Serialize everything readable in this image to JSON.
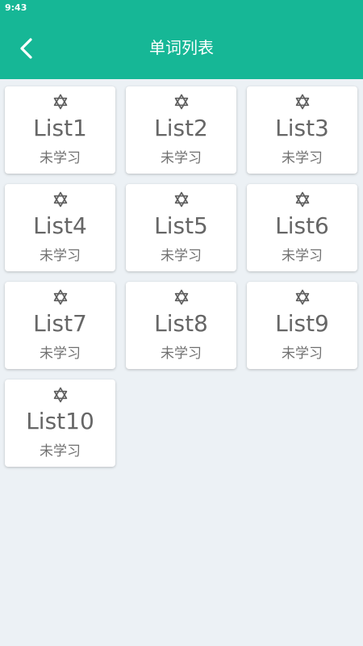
{
  "status_bar": {
    "time": "9:43"
  },
  "header": {
    "title": "单词列表",
    "back_icon": "chevron-left-icon"
  },
  "colors": {
    "accent": "#16b796",
    "background": "#ecf1f5",
    "card": "#ffffff",
    "text": "#666666"
  },
  "lists": [
    {
      "name": "List1",
      "status": "未学习"
    },
    {
      "name": "List2",
      "status": "未学习"
    },
    {
      "name": "List3",
      "status": "未学习"
    },
    {
      "name": "List4",
      "status": "未学习"
    },
    {
      "name": "List5",
      "status": "未学习"
    },
    {
      "name": "List6",
      "status": "未学习"
    },
    {
      "name": "List7",
      "status": "未学习"
    },
    {
      "name": "List8",
      "status": "未学习"
    },
    {
      "name": "List9",
      "status": "未学习"
    },
    {
      "name": "List10",
      "status": "未学习"
    }
  ]
}
